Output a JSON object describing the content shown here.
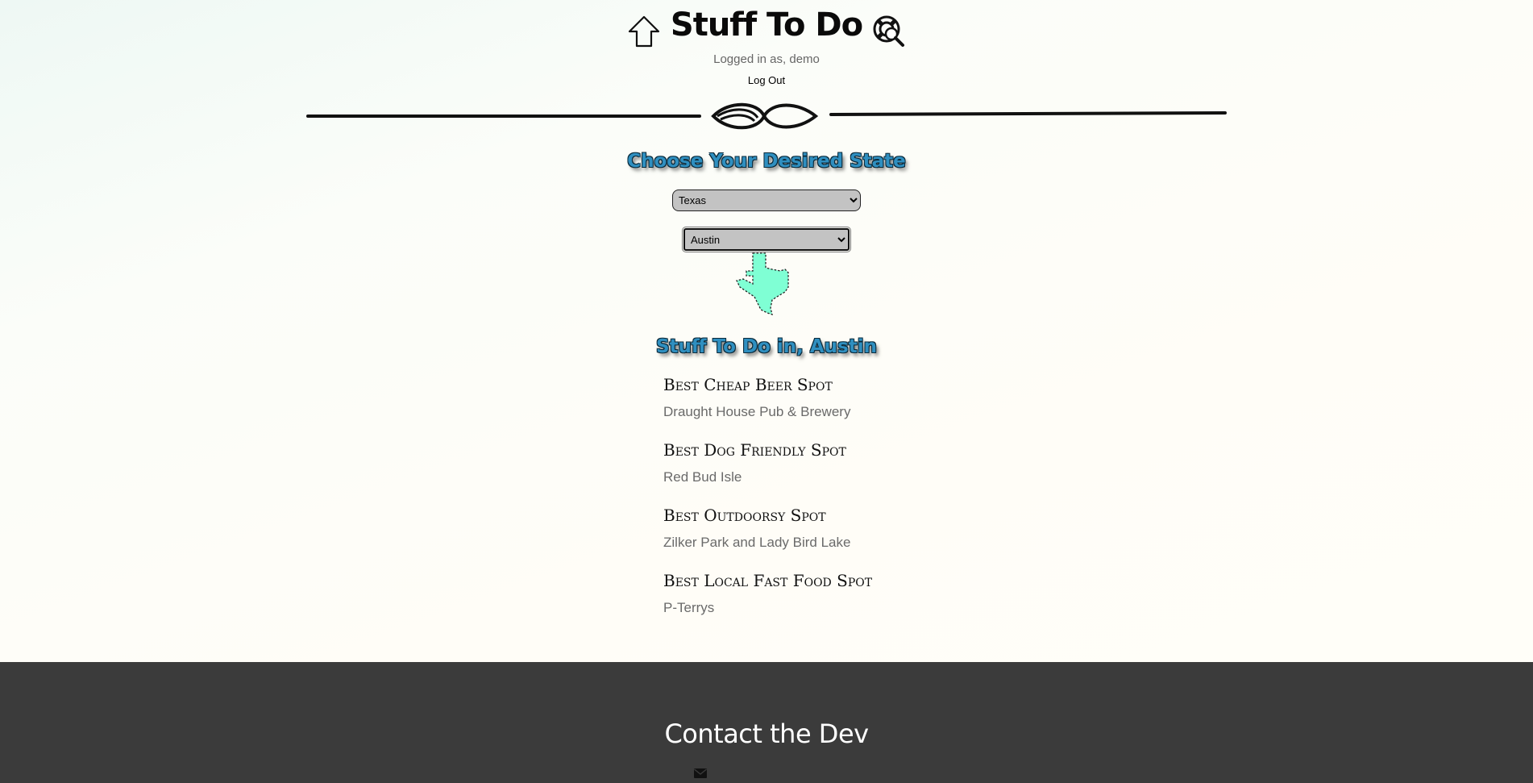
{
  "header": {
    "title": "Stuff To Do",
    "logged_in_text": "Logged in as, demo",
    "logout_label": "Log Out",
    "home_icon": "home-icon",
    "help_icon": "lifebuoy-search-icon"
  },
  "state_picker": {
    "heading": "Choose Your Desired State",
    "state_selected": "Texas",
    "city_selected": "Austin",
    "map_color": "#7fffd4"
  },
  "results": {
    "heading": "Stuff To Do in, Austin",
    "items": [
      {
        "category": "Best Cheap Beer Spot",
        "place": "Draught House Pub & Brewery"
      },
      {
        "category": "Best Dog Friendly Spot",
        "place": "Red Bud Isle"
      },
      {
        "category": "Best Outdoorsy Spot",
        "place": "Zilker Park and Lady Bird Lake"
      },
      {
        "category": "Best Local Fast Food Spot",
        "place": "P-Terrys"
      }
    ]
  },
  "footer": {
    "title": "Contact the Dev",
    "mail_icon": "envelope-icon",
    "background": "#3b3b3b"
  }
}
